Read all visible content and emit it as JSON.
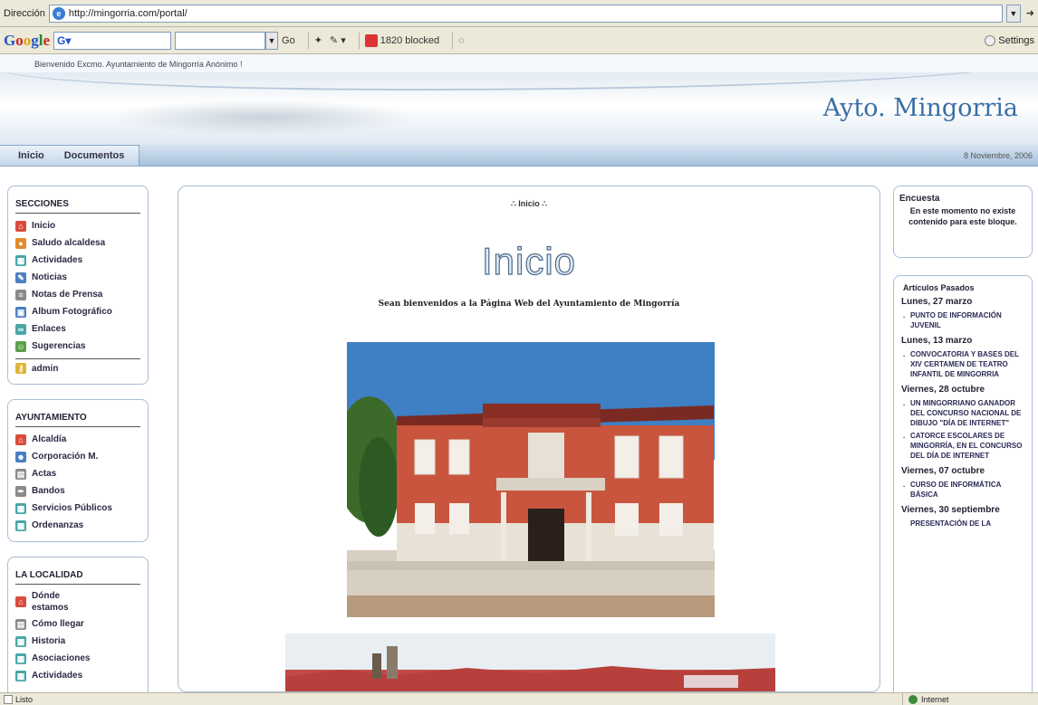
{
  "browser": {
    "address_label": "Dirección",
    "url": "http://mingorria.com/portal/",
    "go_arrow": "Go",
    "google": {
      "logo": "Google",
      "selector": "G",
      "go": "Go",
      "blocked": "1820 blocked",
      "settings": "Settings"
    }
  },
  "site": {
    "welcome": "Bienvenido Excmo. Ayuntamiento de Mingorría Anónimo !",
    "title": "Ayto. Mingorria",
    "nav": [
      "Inicio",
      "Documentos"
    ],
    "date": "8 Noviembre, 2006"
  },
  "sections": {
    "title": "SECCIONES",
    "items": [
      {
        "label": "Inicio",
        "icon": "home-icon",
        "color": "#d94b3b"
      },
      {
        "label": "Saludo alcaldesa",
        "icon": "person-icon",
        "color": "#e38a2e"
      },
      {
        "label": "Actividades",
        "icon": "calendar-icon",
        "color": "#4aa6a6"
      },
      {
        "label": "Noticias",
        "icon": "pencil-icon",
        "color": "#4a7fc0"
      },
      {
        "label": "Notas de Prensa",
        "icon": "newspaper-icon",
        "color": "#8a8a8a"
      },
      {
        "label": "Album Fotográfico",
        "icon": "photo-icon",
        "color": "#4a7fc0"
      },
      {
        "label": "Enlaces",
        "icon": "link-icon",
        "color": "#4aa6a6"
      },
      {
        "label": "Sugerencias",
        "icon": "suggestion-icon",
        "color": "#5a9e4a"
      }
    ],
    "admin": {
      "label": "admin",
      "icon": "key-icon",
      "color": "#e0b43a"
    }
  },
  "ayuntamiento": {
    "title": "AYUNTAMIENTO",
    "items": [
      {
        "label": "Alcaldía",
        "icon": "home-icon",
        "color": "#d94b3b"
      },
      {
        "label": "Corporación M.",
        "icon": "group-icon",
        "color": "#4a7fc0"
      },
      {
        "label": "Actas",
        "icon": "document-icon",
        "color": "#8a8a8a"
      },
      {
        "label": "Bandos",
        "icon": "pen-icon",
        "color": "#8a8a8a"
      },
      {
        "label": "Servicios Públicos",
        "icon": "services-icon",
        "color": "#4aa6a6"
      },
      {
        "label": "Ordenanzas",
        "icon": "rules-icon",
        "color": "#4aa6a6"
      }
    ]
  },
  "localidad": {
    "title": "LA LOCALIDAD",
    "items": [
      {
        "label": "Dónde estamos",
        "icon": "location-icon",
        "color": "#d94b3b"
      },
      {
        "label": "Cómo llegar",
        "icon": "map-icon",
        "color": "#8a8a8a"
      },
      {
        "label": "Historia",
        "icon": "book-icon",
        "color": "#4aa6a6"
      },
      {
        "label": "Asociaciones",
        "icon": "group-icon",
        "color": "#4aa6a6"
      },
      {
        "label": "Actividades",
        "icon": "calendar-icon",
        "color": "#4aa6a6"
      }
    ]
  },
  "main": {
    "breadcrumb": "∴ Inicio ∴",
    "heading": "Inicio",
    "welcome": "Sean bienvenidos a la Página Web del Ayuntamiento de Mingorría"
  },
  "poll": {
    "title": "Encuesta",
    "text": "En este momento no existe contenido para este bloque."
  },
  "past": {
    "title": "Artículos Pasados",
    "groups": [
      {
        "date": "Lunes, 27 marzo",
        "articles": [
          "PUNTO DE INFORMACIÓN JUVENIL"
        ]
      },
      {
        "date": "Lunes, 13 marzo",
        "articles": [
          "CONVOCATORIA Y BASES DEL XIV CERTAMEN DE TEATRO INFANTIL DE MINGORRIA"
        ]
      },
      {
        "date": "Viernes, 28 octubre",
        "articles": [
          "UN MINGORRIANO GANADOR DEL CONCURSO NACIONAL DE DIBUJO \"DÍA DE INTERNET\"",
          "CATORCE ESCOLARES DE MINGORRÍA, EN EL CONCURSO DEL DÍA DE INTERNET"
        ]
      },
      {
        "date": "Viernes, 07 octubre",
        "articles": [
          "CURSO DE INFORMÁTICA BÁSICA"
        ]
      },
      {
        "date": "Viernes, 30 septiembre",
        "articles": [
          "PRESENTACIÓN DE LA"
        ]
      }
    ]
  },
  "status": {
    "text": "Listo",
    "zone": "Internet"
  }
}
